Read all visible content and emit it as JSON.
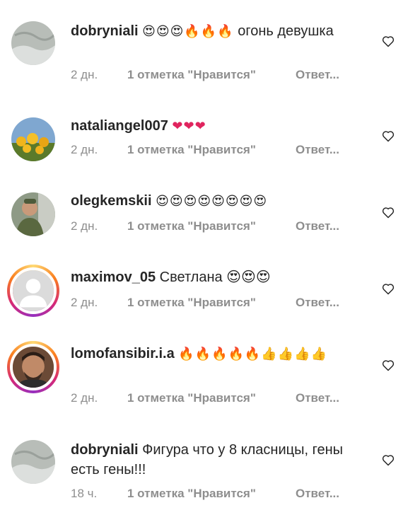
{
  "comments": [
    {
      "user": "dobryniali",
      "emoji": "😍😍😍🔥🔥🔥",
      "text": " огонь девушка",
      "time": "2 дн.",
      "likes": "1 отметка \"Нравится\"",
      "reply": "Ответ..."
    },
    {
      "user": "nataliangel007",
      "emoji": "❤❤❤",
      "text": "",
      "time": "2 дн.",
      "likes": "1 отметка \"Нравится\"",
      "reply": "Ответ..."
    },
    {
      "user": "olegkemskii",
      "emoji": "😍😍😍😍😍😍😍😍",
      "text": "",
      "time": "2 дн.",
      "likes": "1 отметка \"Нравится\"",
      "reply": "Ответ..."
    },
    {
      "user": "maximov_05",
      "emoji": "",
      "text": "Светлана 😍😍😍",
      "time": "2 дн.",
      "likes": "1 отметка \"Нравится\"",
      "reply": "Ответ..."
    },
    {
      "user": "lomofansibir.i.a",
      "emoji": "🔥🔥🔥🔥🔥👍👍👍👍",
      "text": "",
      "time": "2 дн.",
      "likes": "1 отметка \"Нравится\"",
      "reply": "Ответ..."
    },
    {
      "user": "dobryniali",
      "emoji": "",
      "text": "Фигура что у 8 класницы, гены есть гены!!!",
      "time": "18 ч.",
      "likes": "1 отметка \"Нравится\"",
      "reply": "Ответ..."
    }
  ],
  "icons": {
    "like": "heart-outline-icon",
    "avatar_placeholder": "user-silhouette-icon"
  },
  "colors": {
    "text": "#262626",
    "secondary": "#8e8e8e",
    "heart_emoji": "#e0245e"
  }
}
